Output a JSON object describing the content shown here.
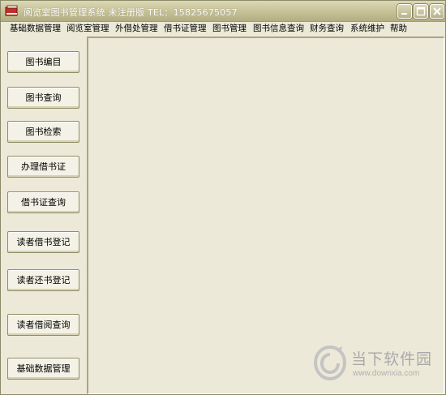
{
  "window": {
    "title": "阅览室图书管理系统 未注册版   TEL：15825675057"
  },
  "menu": {
    "items": [
      {
        "label": "基础数据管理"
      },
      {
        "label": "阅览室管理"
      },
      {
        "label": "外借处管理"
      },
      {
        "label": "借书证管理"
      },
      {
        "label": "图书管理"
      },
      {
        "label": "图书信息查询"
      },
      {
        "label": "财务查询"
      },
      {
        "label": "系统维护"
      },
      {
        "label": "帮助"
      }
    ]
  },
  "nav": {
    "buttons": [
      {
        "label": "图书编目"
      },
      {
        "label": "图书查询"
      },
      {
        "label": "图书检索"
      },
      {
        "label": "办理借书证"
      },
      {
        "label": "借书证查询"
      },
      {
        "label": "读者借书登记"
      },
      {
        "label": "读者还书登记"
      },
      {
        "label": "读者借阅查询"
      },
      {
        "label": "基础数据管理"
      }
    ]
  },
  "watermark": {
    "title": "当下软件园",
    "url": "www.downxia.com"
  },
  "colors": {
    "background": "#ECE9D8",
    "titlebar": "#C5C096",
    "watermark_gray": "#A9A9A9"
  }
}
